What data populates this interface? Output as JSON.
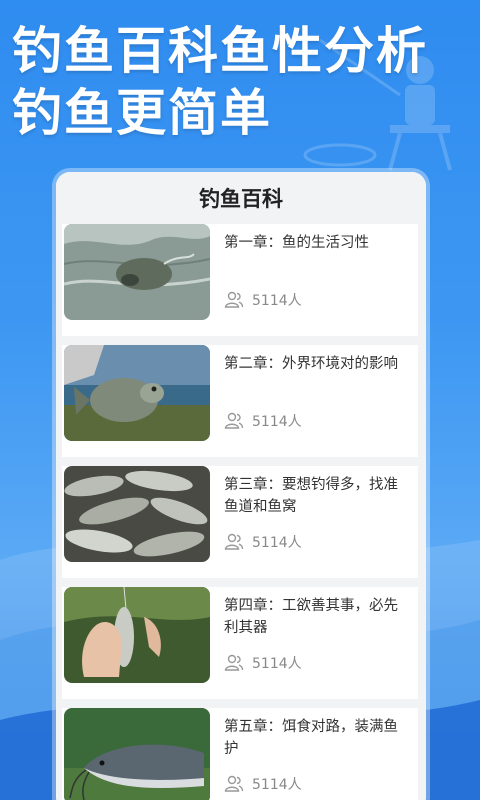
{
  "banner": {
    "line1": "钓鱼百科鱼性分析",
    "line2": "钓鱼更简单"
  },
  "card": {
    "title": "钓鱼百科",
    "items": [
      {
        "title": "第一章：鱼的生活习性",
        "count": "5114人",
        "image": "carp-in-water"
      },
      {
        "title": "第二章：外界环境对的影响",
        "count": "5114人",
        "image": "caught-fish-held"
      },
      {
        "title": "第三章：要想钓得多，找准鱼道和鱼窝",
        "count": "5114人",
        "image": "pile-of-fish"
      },
      {
        "title": "第四章：工欲善其事，必先利其器",
        "count": "5114人",
        "image": "fish-on-hook"
      },
      {
        "title": "第五章：饵食对路，装满鱼护",
        "count": "5114人",
        "image": "catfish"
      }
    ]
  },
  "colors": {
    "background": "#2f8cf0",
    "card": "#f2f3f5",
    "text": "#333333",
    "meta": "#888888"
  }
}
